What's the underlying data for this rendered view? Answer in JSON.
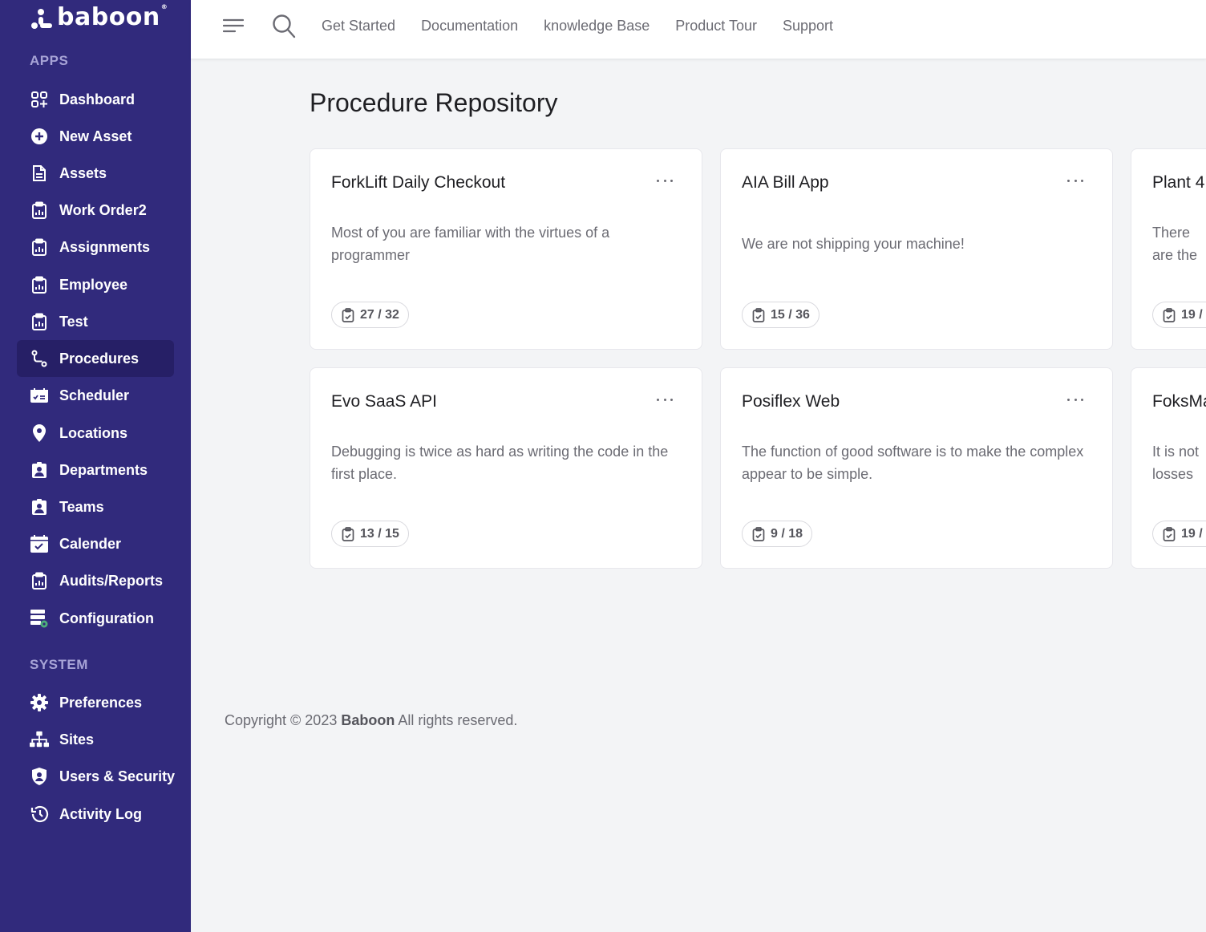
{
  "brand": {
    "name": "baboon",
    "reg": "®"
  },
  "sidebar": {
    "apps_title": "APPS",
    "system_title": "SYSTEM",
    "apps": [
      {
        "label": "Dashboard",
        "icon": "grid-plus-icon"
      },
      {
        "label": "New Asset",
        "icon": "plus-circle-icon"
      },
      {
        "label": "Assets",
        "icon": "document-icon"
      },
      {
        "label": "Work Order2",
        "icon": "clipboard-chart-icon"
      },
      {
        "label": "Assignments",
        "icon": "clipboard-chart-icon"
      },
      {
        "label": "Employee",
        "icon": "clipboard-chart-icon"
      },
      {
        "label": "Test",
        "icon": "clipboard-chart-icon"
      },
      {
        "label": "Procedures",
        "icon": "route-icon",
        "active": true
      },
      {
        "label": "Scheduler",
        "icon": "calendar-check-icon"
      },
      {
        "label": "Locations",
        "icon": "map-pin-icon"
      },
      {
        "label": "Departments",
        "icon": "id-badge-icon"
      },
      {
        "label": "Teams",
        "icon": "id-badge-icon"
      },
      {
        "label": "Calender",
        "icon": "calendar-icon"
      },
      {
        "label": "Audits/Reports",
        "icon": "clipboard-chart-icon"
      },
      {
        "label": "Configuration",
        "icon": "server-gear-icon"
      }
    ],
    "system": [
      {
        "label": "Preferences",
        "icon": "gear-icon"
      },
      {
        "label": "Sites",
        "icon": "sitemap-icon"
      },
      {
        "label": "Users & Security",
        "icon": "shield-user-icon"
      },
      {
        "label": "Activity Log",
        "icon": "history-icon"
      }
    ]
  },
  "topbar": {
    "links": [
      "Get Started",
      "Documentation",
      "knowledge Base",
      "Product Tour",
      "Support"
    ]
  },
  "main": {
    "title": "Procedure Repository",
    "cards": [
      {
        "title": "ForkLift Daily Checkout",
        "description": "Most of you are familiar with the virtues of a programmer",
        "progress": "27 / 32"
      },
      {
        "title": "AIA Bill App",
        "description": "We are not shipping your machine!",
        "progress": "15 / 36"
      },
      {
        "title": "Plant 4",
        "description": "There are the third",
        "progress": "19 /"
      },
      {
        "title": "Evo SaaS API",
        "description": "Debugging is twice as hard as writing the code in the first place.",
        "progress": "13 / 15"
      },
      {
        "title": "Posiflex Web",
        "description": "The function of good software is to make the complex appear to be simple.",
        "progress": "9 / 18"
      },
      {
        "title": "FoksMa",
        "description": "It is not losses a",
        "progress": "19 /"
      }
    ]
  },
  "footer": {
    "prefix": "Copyright © 2023 ",
    "brand": "Baboon",
    "suffix": " All rights reserved."
  }
}
